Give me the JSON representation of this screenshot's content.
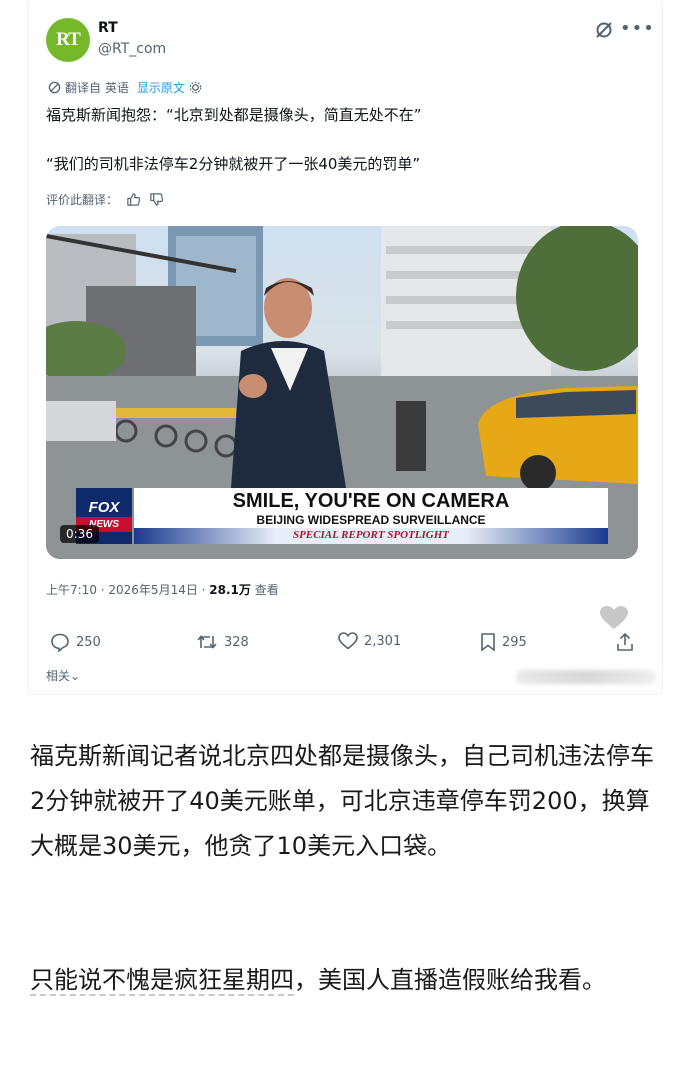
{
  "tweet": {
    "avatar_text": "RT",
    "account_name": "RT",
    "handle": "@RT_com",
    "translate": {
      "from_label": "翻译自 英语",
      "show_original": "显示原文"
    },
    "line1": "福克斯新闻抱怨：“北京到处都是摄像头，简直无处不在”",
    "line2": "“我们的司机非法停车2分钟就被开了一张40美元的罚单”",
    "rate_label": "评价此翻译：",
    "video": {
      "headline": "SMILE, YOU'RE ON CAMERA",
      "subhead": "BEIJING WIDESPREAD SURVEILLANCE",
      "spotlight": "SPECIAL REPORT SPOTLIGHT",
      "logo_line1": "FOX",
      "logo_line2": "NEWS",
      "duration": "0:36"
    },
    "timestamp": "上午7:10 · 2026年5月14日 · ",
    "views": "28.1万",
    "views_suffix": " 查看",
    "stats": {
      "replies": "250",
      "reposts": "328",
      "likes": "2,301",
      "bookmarks": "295"
    },
    "related": "相关⌄"
  },
  "comment": {
    "paragraph1": "福克斯新闻记者说北京四处都是摄像头，自己司机违法停车2分钟就被开了40美元账单，可北京违章停车罚200，换算大概是30美元，他贪了10美元入口袋。",
    "paragraph2_underlined": "只能说不愧是疯狂星期四",
    "paragraph2_rest": "，美国人直播造假账给我看。"
  },
  "colors": {
    "accent": "#1d9bf0",
    "rt_green": "#76b82a",
    "fox_blue": "#0f2a6b",
    "fox_red": "#c8102e"
  }
}
